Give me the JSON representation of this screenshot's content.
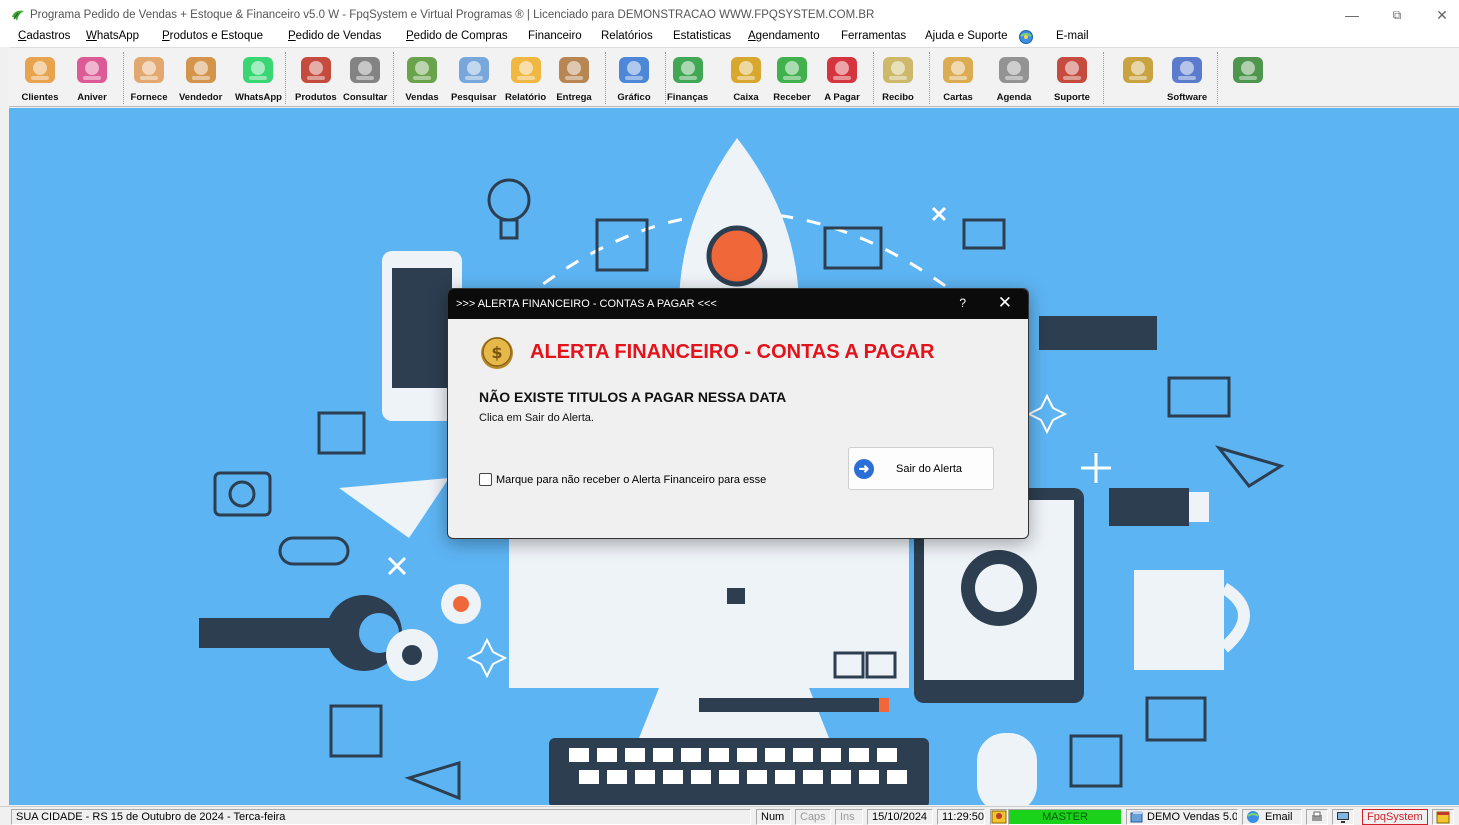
{
  "window": {
    "title": "Programa Pedido de Vendas + Estoque & Financeiro v5.0 W - FpqSystem e Virtual Programas ® | Licenciado para  DEMONSTRACAO WWW.FPQSYSTEM.COM.BR",
    "minimize": "—",
    "restore": "⧉",
    "close": "✕"
  },
  "menu": [
    {
      "u": "C",
      "rest": "adastros"
    },
    {
      "u": "W",
      "rest": "hatsApp"
    },
    {
      "u": "P",
      "rest": "rodutos e Estoque"
    },
    {
      "u": "P",
      "rest": "edido de Vendas"
    },
    {
      "u": "P",
      "rest": "edido de Compras"
    },
    {
      "u": "",
      "rest": "Financeiro"
    },
    {
      "u": "",
      "rest": "Relatórios"
    },
    {
      "u": "",
      "rest": "Estatisticas"
    },
    {
      "u": "A",
      "rest": "gendamento"
    },
    {
      "u": "",
      "rest": "Ferramentas"
    },
    {
      "u": "",
      "rest": "Ajuda e Suporte"
    },
    {
      "u": "",
      "rest": "E-mail"
    }
  ],
  "toolbar": [
    {
      "label": "Clientes",
      "icon": "clients-icon",
      "color": "#e59a3b"
    },
    {
      "label": "Aniver",
      "icon": "birthday-cake-icon",
      "color": "#d94a8c"
    },
    {
      "label": "Fornece",
      "icon": "supplier-icon",
      "color": "#e0a060"
    },
    {
      "label": "Vendedor",
      "icon": "seller-icon",
      "color": "#d08a3a"
    },
    {
      "label": "WhatsApp",
      "icon": "whatsapp-icon",
      "color": "#25d366"
    },
    {
      "label": "Produtos",
      "icon": "products-icon",
      "color": "#c0392b"
    },
    {
      "label": "Consultar",
      "icon": "barcode-icon",
      "color": "#777777"
    },
    {
      "label": "Vendas",
      "icon": "cart-icon",
      "color": "#5a9a3a"
    },
    {
      "label": "Pesquisar",
      "icon": "search-icon",
      "color": "#6aa0d8"
    },
    {
      "label": "Relatório",
      "icon": "report-icon",
      "color": "#f0b030"
    },
    {
      "label": "Entrega",
      "icon": "delivery-icon",
      "color": "#b07a40"
    },
    {
      "label": "Gráfico",
      "icon": "chart-icon",
      "color": "#3a7bd5"
    },
    {
      "label": "Finanças",
      "icon": "finance-icon",
      "color": "#2f9e44"
    },
    {
      "label": "Caixa",
      "icon": "cashbox-icon",
      "color": "#d4a017"
    },
    {
      "label": "Receber",
      "icon": "receive-money-icon",
      "color": "#2eaa3c"
    },
    {
      "label": "A Pagar",
      "icon": "pay-money-icon",
      "color": "#d0202a"
    },
    {
      "label": "Recibo",
      "icon": "receipt-icon",
      "color": "#c9b35a"
    },
    {
      "label": "Cartas",
      "icon": "letters-icon",
      "color": "#d9a441"
    },
    {
      "label": "Agenda",
      "icon": "agenda-icon",
      "color": "#888888"
    },
    {
      "label": "Suporte",
      "icon": "support-icon",
      "color": "#c0392b"
    },
    {
      "label": "",
      "icon": "coin-icon",
      "color": "#c59a2e"
    },
    {
      "label": "Software",
      "icon": "software-icon",
      "color": "#4a6fc9"
    },
    {
      "label": "",
      "icon": "exit-icon",
      "color": "#3c8c3c"
    }
  ],
  "dialog": {
    "title": ">>> ALERTA FINANCEIRO - CONTAS A PAGAR <<<",
    "help": "?",
    "close": "✕",
    "heading": "ALERTA FINANCEIRO - CONTAS A PAGAR",
    "message": "NÃO EXISTE TITULOS A PAGAR NESSA DATA",
    "instruction": "Clica em Sair do Alerta.",
    "checkbox_label": "Marque para não receber o Alerta Financeiro para esse",
    "exit_button": "Sair do Alerta"
  },
  "status": {
    "location_date": "SUA CIDADE - RS 15 de Outubro de 2024 - Terca-feira",
    "num": "Num",
    "caps": "Caps",
    "ins": "Ins",
    "date": "15/10/2024",
    "time": "11:29:50",
    "user": "MASTER",
    "version": "DEMO Vendas 5.0",
    "email": "Email",
    "brand": "FpqSystem"
  }
}
